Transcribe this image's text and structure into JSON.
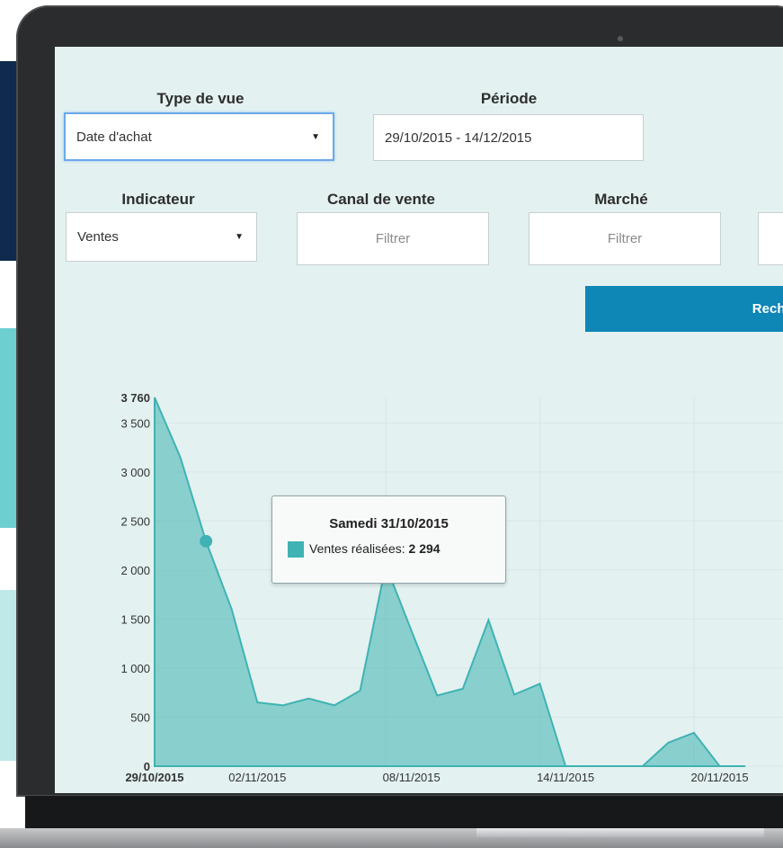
{
  "filters": {
    "type_de_vue": {
      "label": "Type de vue",
      "value": "Date d'achat"
    },
    "periode": {
      "label": "Période",
      "value": "29/10/2015 - 14/12/2015"
    },
    "indicateur": {
      "label": "Indicateur",
      "value": "Ventes"
    },
    "canal_de_vente": {
      "label": "Canal de vente",
      "placeholder": "Filtrer"
    },
    "marche": {
      "label": "Marché",
      "placeholder": "Filtrer"
    }
  },
  "reload_label": "Recharger",
  "tooltip": {
    "title": "Samedi 31/10/2015",
    "series_label": "Ventes réalisées:",
    "value": "2 294"
  },
  "colors": {
    "area_fill": "#3fb3b3",
    "accent_button": "#0e86b6"
  },
  "chart_data": {
    "type": "area",
    "x": [
      "29/10",
      "30/10",
      "31/10",
      "01/11",
      "02/11",
      "03/11",
      "04/11",
      "05/11",
      "06/11",
      "07/11",
      "08/11",
      "09/11",
      "10/11",
      "11/11",
      "12/11",
      "13/11",
      "14/11",
      "15/11",
      "16/11",
      "17/11",
      "18/11",
      "19/11",
      "20/11",
      "21/11"
    ],
    "series": [
      {
        "name": "Ventes réalisées",
        "values": [
          3760,
          3150,
          2294,
          1600,
          650,
          620,
          690,
          620,
          770,
          2050,
          1380,
          720,
          790,
          1490,
          730,
          840,
          0,
          0,
          0,
          0,
          240,
          340,
          0,
          0
        ]
      }
    ],
    "x_tick_labels": [
      "29/10/2015",
      "02/11/2015",
      "08/11/2015",
      "14/11/2015",
      "20/11/2015"
    ],
    "y_tick_labels": [
      "0",
      "500",
      "1 000",
      "1 500",
      "2 000",
      "2 500",
      "3 000",
      "3 500",
      "3 760"
    ],
    "ylim": [
      0,
      3760
    ],
    "grid": true,
    "highlighted_point": {
      "x": "31/10",
      "value": 2294
    }
  }
}
